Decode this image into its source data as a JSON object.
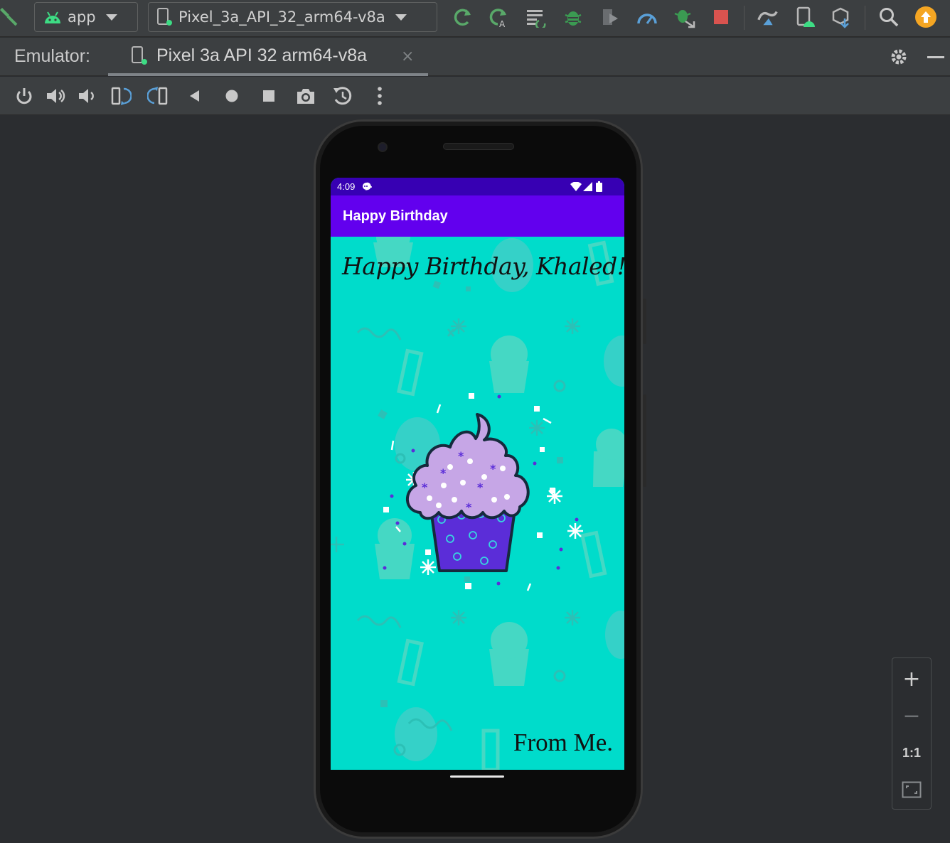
{
  "toolbar": {
    "module": "app",
    "device": "Pixel_3a_API_32_arm64-v8a",
    "icons": [
      "hammer-icon",
      "apply-changes-icon",
      "apply-code-changes-icon",
      "run-configurations-icon",
      "debug-icon",
      "profile-icon",
      "profiler-icon",
      "attach-debugger-icon",
      "stop-icon",
      "sync-icon",
      "device-manager-icon",
      "sdk-manager-icon",
      "search-icon",
      "update-icon"
    ],
    "colors": {
      "stop": "#d9534f",
      "update": "#f5a623",
      "accent_green": "#59a869",
      "debug_green": "#3b9a52"
    }
  },
  "emulator": {
    "label": "Emulator:",
    "tab_title": "Pixel 3a API 32 arm64-v8a",
    "close": "×"
  },
  "controls": [
    "power-icon",
    "volume-up-icon",
    "volume-down-icon",
    "rotate-left-icon",
    "rotate-right-icon",
    "back-icon",
    "home-icon",
    "overview-icon",
    "screenshot-icon",
    "snapshot-icon",
    "more-icon"
  ],
  "device": {
    "time": "4:09",
    "app_title": "Happy Birthday",
    "greeting": "Happy Birthday, Khaled!",
    "signature": "From Me.",
    "colors": {
      "status_bar": "#3700b3",
      "app_bar": "#6200ee",
      "background": "#00dccb",
      "frosting": "#c6a6e6",
      "cup": "#5b2dd8"
    }
  },
  "zoom": {
    "in": "+",
    "out": "−",
    "actual": "1:1",
    "fit": "fit-screen-icon"
  }
}
